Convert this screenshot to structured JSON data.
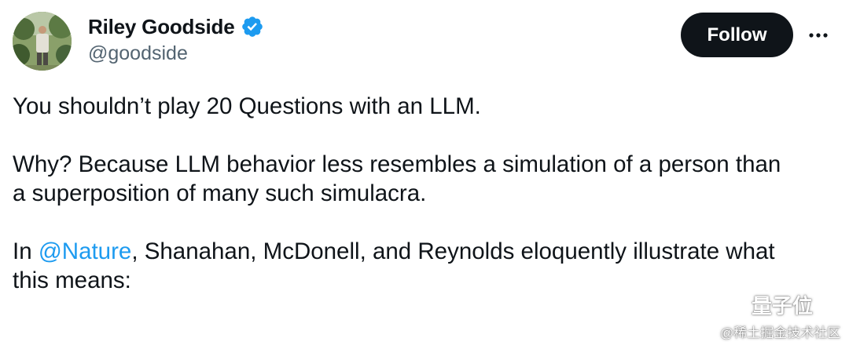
{
  "author": {
    "display_name": "Riley Goodside",
    "handle": "@goodside",
    "verified": true
  },
  "actions": {
    "follow_label": "Follow",
    "more_icon": "more-horizontal-icon"
  },
  "tweet": {
    "line1": "You shouldn’t play 20 Questions with an LLM.",
    "line2": "Why? Because LLM behavior less resembles a simulation of a person than a superposition of many such simulacra.",
    "p3_prefix": "In ",
    "p3_mention": "@Nature",
    "p3_suffix": ", Shanahan, McDonell, and Reynolds eloquently illustrate what this means:"
  },
  "watermark": {
    "main": "量子位",
    "sub": "@稀土掘金技术社区"
  },
  "colors": {
    "accent": "#1d9bf0",
    "text": "#0f1419",
    "secondary": "#536471",
    "follow_bg": "#0f1419"
  }
}
